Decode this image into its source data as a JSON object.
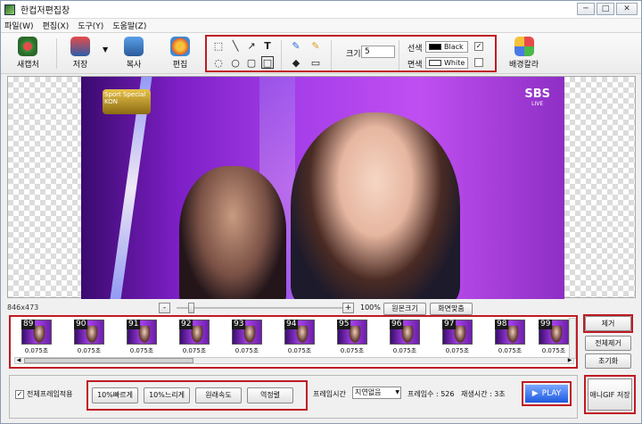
{
  "window": {
    "title": "한컵저편집창",
    "controls": [
      "─",
      "□",
      "✕"
    ]
  },
  "menu": [
    "파일(W)",
    "편집(X)",
    "도구(Y)",
    "도움말(Z)"
  ],
  "toolbar": {
    "new_label": "새캡처",
    "save_label": "저장",
    "copy_label": "복사",
    "edit_label": "편집",
    "size_label": "크기",
    "size_value": "5",
    "line_color_label": "선색",
    "line_color_value": "Black",
    "fill_color_label": "면색",
    "fill_color_value": "White",
    "bg_color_label": "배경칼라"
  },
  "canvas": {
    "dims": "846x473",
    "zoom": "100%",
    "original_size_button": "원본크기",
    "fit_screen_button": "화면맞춤",
    "watermark": "SBS",
    "watermark_sub": "LIVE",
    "logo_text": "Sport Special",
    "logo_sub": "KON"
  },
  "frames": [
    {
      "num": "89",
      "delay": "0.075초"
    },
    {
      "num": "90",
      "delay": "0.075초"
    },
    {
      "num": "91",
      "delay": "0.075초"
    },
    {
      "num": "92",
      "delay": "0.075초"
    },
    {
      "num": "93",
      "delay": "0.075초"
    },
    {
      "num": "94",
      "delay": "0.075초"
    },
    {
      "num": "95",
      "delay": "0.075초"
    },
    {
      "num": "96",
      "delay": "0.075초"
    },
    {
      "num": "97",
      "delay": "0.075초"
    },
    {
      "num": "98",
      "delay": "0.075초"
    },
    {
      "num": "99",
      "delay": "0.075초"
    }
  ],
  "side_buttons": {
    "remove": "제거",
    "remove_all": "전체제거",
    "reset": "초기화"
  },
  "bottom": {
    "all_frames_label": "전체프레임적용",
    "faster": "10%빠르게",
    "slower": "10%느리게",
    "original_speed": "원래속도",
    "reverse": "역정렬",
    "frame_time_label": "프레임시간",
    "frame_time_value": "지연없음",
    "frame_count": "프레임수 : 526",
    "play_time": "재생시간 : 3초",
    "play": "PLAY",
    "save_gif": "애니GIF 저장"
  },
  "colors": {
    "highlight": "#c01b24",
    "play_button": "#1e5ae0"
  }
}
